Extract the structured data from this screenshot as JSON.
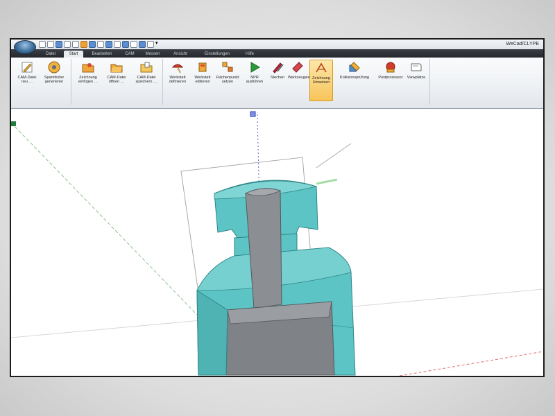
{
  "app": {
    "title": "WeCad/CLYPE"
  },
  "quick_access": [
    "qa-new",
    "qa-open",
    "qa-save",
    "qa-undo",
    "qa-redo",
    "qa-1",
    "qa-2",
    "qa-3",
    "qa-4",
    "qa-5",
    "qa-6",
    "qa-7",
    "qa-8",
    "qa-9",
    "qa-10"
  ],
  "menu": {
    "tabs": [
      {
        "label": "Datei",
        "active": false
      },
      {
        "label": "Start",
        "active": true
      },
      {
        "label": "Bearbeiten",
        "active": false
      },
      {
        "label": "CAM",
        "active": false
      },
      {
        "label": "Messen",
        "active": false
      },
      {
        "label": "Ansicht",
        "active": false
      },
      {
        "label": "Einstellungen",
        "active": false
      },
      {
        "label": "Hilfe",
        "active": false
      }
    ]
  },
  "ribbon": {
    "buttons": [
      {
        "label": "CAM-Datei neu …",
        "icon": "pen-icon"
      },
      {
        "label": "Spannfutter generieren",
        "icon": "chuck-icon"
      },
      {
        "label": "Zeichnung einfügen …",
        "icon": "folder-icon"
      },
      {
        "label": "CAM-Datei öffnen …",
        "icon": "folder-icon"
      },
      {
        "label": "CAM-Datei speichern …",
        "icon": "folder-icon"
      },
      {
        "label": "Werkstatt definieren",
        "icon": "brush-icon"
      },
      {
        "label": "Werkstatt editieren",
        "icon": "edit-icon"
      },
      {
        "label": "Flächenpunkt setzen",
        "icon": "points-icon"
      },
      {
        "label": "NPR ausführen",
        "icon": "play-icon"
      },
      {
        "label": "Stechen",
        "icon": "tool-icon"
      },
      {
        "label": "Werkzeugwahl",
        "icon": "tool-icon"
      },
      {
        "label": "Zeichnung Umsetzen",
        "icon": "drawing-icon",
        "active": true
      },
      {
        "label": "Kollisionsprüfung",
        "icon": "collision-icon"
      },
      {
        "label": "Postprozessor",
        "icon": "post-icon"
      },
      {
        "label": "Viewplätze",
        "icon": "view-icon"
      }
    ]
  },
  "colors": {
    "part_cyan": "#5cc4c4",
    "part_cyan_dark": "#3f9ea0",
    "shaft_gray": "#8b8e92",
    "shaft_gray_dark": "#6e7175",
    "axis_blue": "#2f3fbf",
    "axis_green": "#2e8b57",
    "axis_red": "#d63c3c",
    "active_button": "#f7c45a"
  }
}
